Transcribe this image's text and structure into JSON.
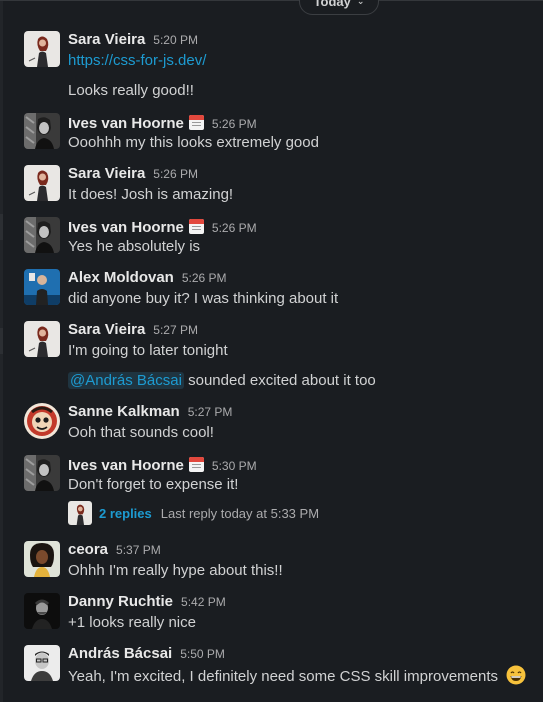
{
  "divider": {
    "label": "Today"
  },
  "messages": [
    {
      "name": "Sara Vieira",
      "time": "5:20 PM",
      "lines": [
        "https://css-for-js.dev/"
      ],
      "followup": "Looks really good!!"
    },
    {
      "name": "Ives van Hoorne",
      "time": "5:26 PM",
      "text": "Ooohhh my this looks extremely good"
    },
    {
      "name": "Sara Vieira",
      "time": "5:26 PM",
      "text": "It does! Josh is amazing!"
    },
    {
      "name": "Ives van Hoorne",
      "time": "5:26 PM",
      "text": "Yes he absolutely is"
    },
    {
      "name": "Alex Moldovan",
      "time": "5:26 PM",
      "text": "did anyone buy it? I was thinking about it"
    },
    {
      "name": "Sara Vieira",
      "time": "5:27 PM",
      "text": "I'm going to later tonight",
      "mention": "@András Bácsai",
      "mention_rest": "sounded excited about it too"
    },
    {
      "name": "Sanne Kalkman",
      "time": "5:27 PM",
      "text": "Ooh that sounds cool!"
    },
    {
      "name": "Ives van Hoorne",
      "time": "5:30 PM",
      "text": "Don't forget to expense it!",
      "thread": {
        "replies": "2 replies",
        "last": "Last reply today at 5:33 PM"
      }
    },
    {
      "name": "ceora",
      "time": "5:37 PM",
      "text": "Ohhh I'm really hype about this!!"
    },
    {
      "name": "Danny Ruchtie",
      "time": "5:42 PM",
      "text": "+1 looks really nice"
    },
    {
      "name": "András Bácsai",
      "time": "5:50 PM",
      "text": "Yeah, I'm excited, I definitely need some CSS skill improvements"
    }
  ],
  "icons": {
    "status": "calendar-icon",
    "reaction": "grinning-face-emoji"
  },
  "colors": {
    "background": "#1a1d21",
    "link": "#1d9bd1",
    "name": "#e8e8e8",
    "text": "#d1d2d3",
    "meta": "#ababad"
  }
}
